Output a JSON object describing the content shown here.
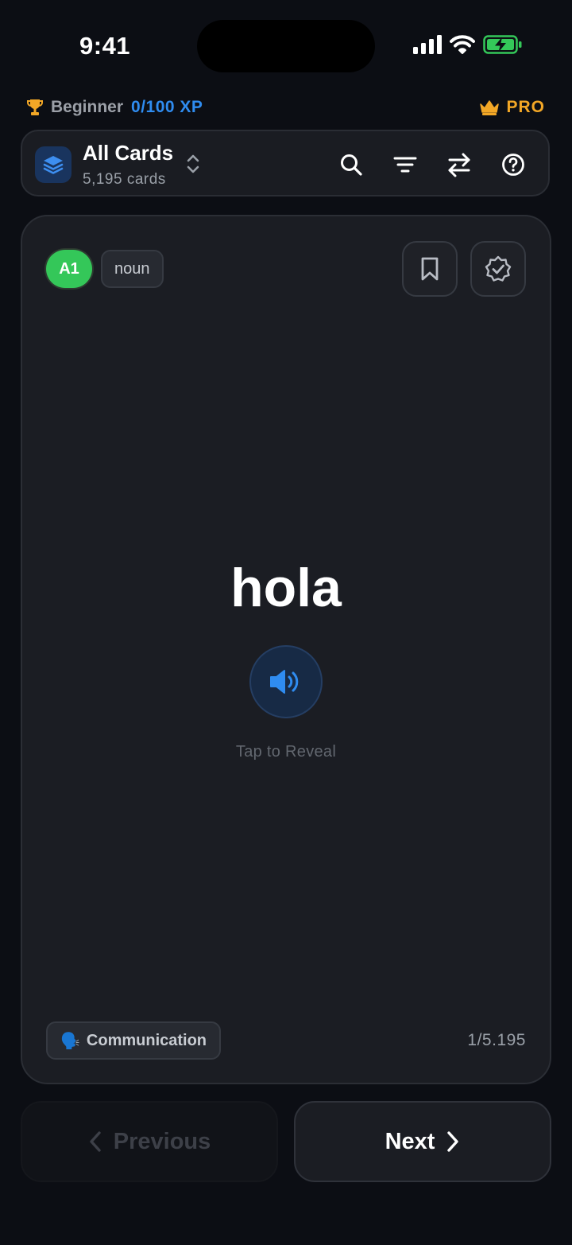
{
  "status_bar": {
    "time": "9:41"
  },
  "level": {
    "name": "Beginner",
    "xp": "0/100 XP",
    "pro_label": "PRO"
  },
  "deck": {
    "title": "All Cards",
    "count": "5,195 cards"
  },
  "toolbar": {
    "icons": [
      "search-icon",
      "filter-icon",
      "swap-icon",
      "help-icon"
    ]
  },
  "card": {
    "level_badge": "A1",
    "part_of_speech": "noun",
    "word": "hola",
    "hint": "Tap to Reveal",
    "category_emoji": "🗣️",
    "category": "Communication",
    "progress": "1/5.195"
  },
  "nav": {
    "previous_label": "Previous",
    "next_label": "Next"
  },
  "colors": {
    "background": "#0c0e14",
    "accent_blue": "#2f8cf0",
    "pro_gold": "#f3a726",
    "level_green": "#34c759",
    "battery_green": "#34c759"
  }
}
